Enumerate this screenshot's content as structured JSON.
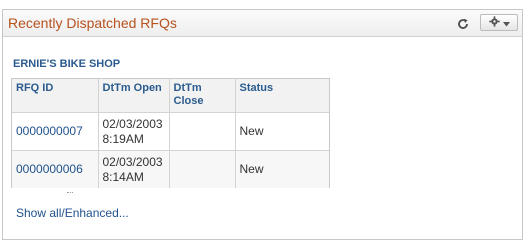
{
  "pagelet": {
    "title": "Recently Dispatched RFQs",
    "refresh_icon": "refresh-icon",
    "options_icon": "gear-icon"
  },
  "company": "ERNIE'S BIKE SHOP",
  "grid": {
    "columns": [
      "RFQ ID",
      "DtTm Open",
      "DtTm Close",
      "Status"
    ],
    "rows": [
      {
        "rfq_id": "0000000007",
        "open": "02/03/2003 8:19AM",
        "close": "",
        "status": "New"
      },
      {
        "rfq_id": "0000000006",
        "open": "02/03/2003 8:14AM",
        "close": "",
        "status": "New"
      }
    ]
  },
  "show_all_link": "Show all/Enhanced...",
  "colors": {
    "title": "#b7511d",
    "link": "#21528d",
    "header_text": "#2b5b8e"
  }
}
